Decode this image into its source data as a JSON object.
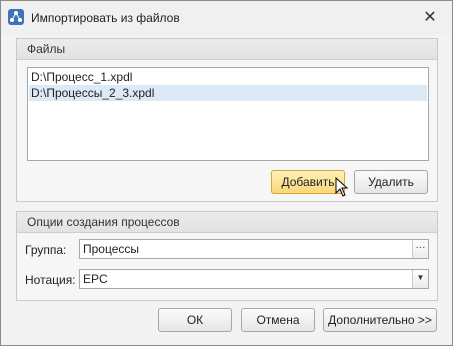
{
  "window": {
    "title": "Импортировать из файлов",
    "close_glyph": "✕",
    "icon": "app-network-icon"
  },
  "files_group": {
    "header": "Файлы",
    "files": [
      {
        "path": "D:\\Процесс_1.xpdl",
        "selected": false
      },
      {
        "path": "D:\\Процессы_2_3.xpdl",
        "selected": true
      }
    ],
    "add_label": "Добавить",
    "delete_label": "Удалить"
  },
  "options_group": {
    "header": "Опции создания процессов",
    "group_label": "Группа:",
    "group_value": "Процессы",
    "group_browse_glyph": "···",
    "notation_label": "Нотация:",
    "notation_value": "EPC",
    "notation_dropdown_glyph": "▼"
  },
  "footer": {
    "ok_label": "ОК",
    "cancel_label": "Отмена",
    "more_label": "Дополнительно >>"
  },
  "colors": {
    "accent_hover": "#f8d77a",
    "selection": "#dce9f7",
    "icon_blue": "#3e74b8"
  }
}
